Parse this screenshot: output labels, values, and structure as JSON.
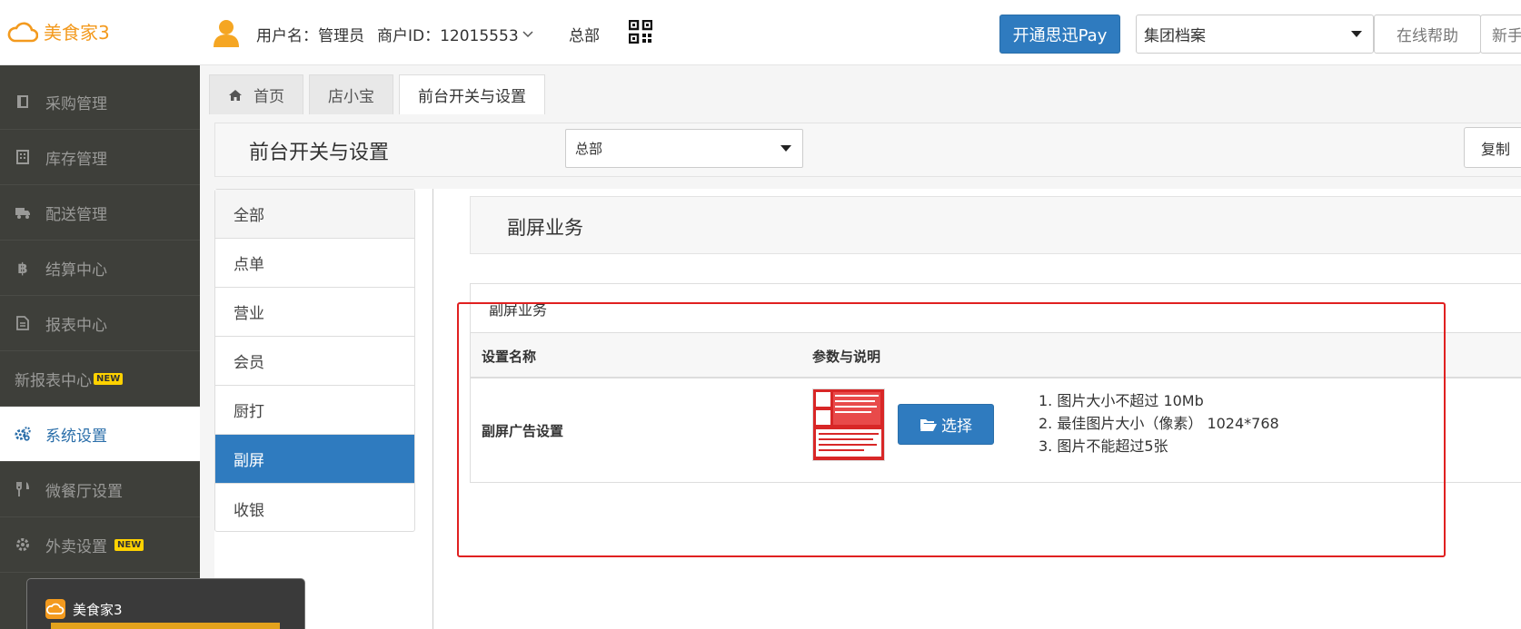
{
  "header": {
    "logo_text": "美食家3",
    "username_label": "用户名：管理员",
    "merchant_label": "商户ID：12015553",
    "hq_label": "总部",
    "pay_button": "开通思迅Pay",
    "group_select": "集团档案",
    "help_button": "在线帮助",
    "newbie_button": "新手"
  },
  "sidebar": {
    "items": [
      {
        "label": "采购管理",
        "icon": "book-icon"
      },
      {
        "label": "库存管理",
        "icon": "building-icon"
      },
      {
        "label": "配送管理",
        "icon": "truck-icon"
      },
      {
        "label": "结算中心",
        "icon": "bitcoin-icon"
      },
      {
        "label": "报表中心",
        "icon": "file-icon"
      },
      {
        "label": "新报表中心",
        "badge": "NEW"
      },
      {
        "label": "系统设置",
        "icon": "cogs-icon",
        "active": true
      },
      {
        "label": "微餐厅设置",
        "icon": "cutlery-icon"
      },
      {
        "label": "外卖设置",
        "icon": "gear-icon",
        "badge": "NEW"
      }
    ]
  },
  "tabs": [
    {
      "label": "首页"
    },
    {
      "label": "店小宝"
    },
    {
      "label": "前台开关与设置"
    }
  ],
  "toolbar": {
    "title": "前台开关与设置",
    "store_select": "总部",
    "copy_button": "复制"
  },
  "categories": [
    "全部",
    "点单",
    "营业",
    "会员",
    "厨打",
    "副屏",
    "收银"
  ],
  "section": {
    "title": "副屏业务",
    "panel_heading": "副屏业务",
    "col_name": "设置名称",
    "col_params": "参数与说明",
    "row_name": "副屏广告设置",
    "select_button": "选择",
    "notes": [
      "1. 图片大小不超过 10Mb",
      "2. 最佳图片大小（像素） 1024*768",
      "3. 图片不能超过5张"
    ]
  },
  "popup": {
    "title": "美食家3"
  },
  "colors": {
    "brand_orange": "#f39a1e",
    "primary_blue": "#2f7bbf",
    "sidebar_bg": "#3e3f3a",
    "highlight_red": "#e02020"
  }
}
